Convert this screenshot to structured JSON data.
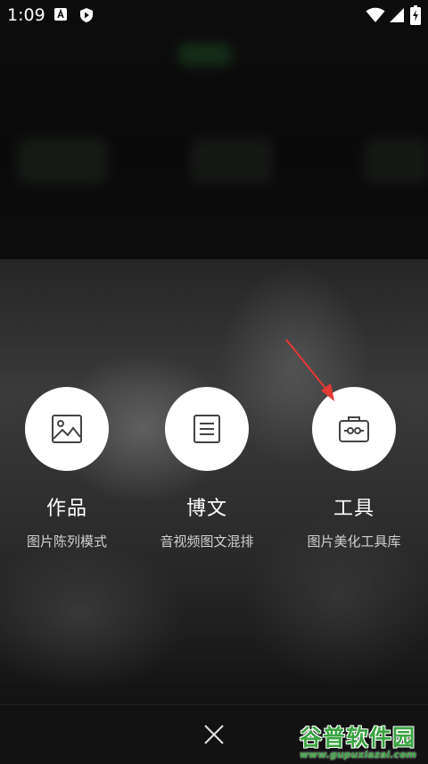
{
  "status_bar": {
    "time": "1:09"
  },
  "options": [
    {
      "title": "作品",
      "desc": "图片陈列模式",
      "icon": "image-icon"
    },
    {
      "title": "博文",
      "desc": "音视频图文混排",
      "icon": "document-icon"
    },
    {
      "title": "工具",
      "desc": "图片美化工具库",
      "icon": "toolbox-icon"
    }
  ],
  "watermark": {
    "title": "谷普软件园",
    "url": "www.gupuxiazai.com"
  },
  "colors": {
    "overlay": "#0d0d0d",
    "circle": "#ffffff",
    "annotation_arrow": "#e53935",
    "watermark": "#3aa341"
  }
}
